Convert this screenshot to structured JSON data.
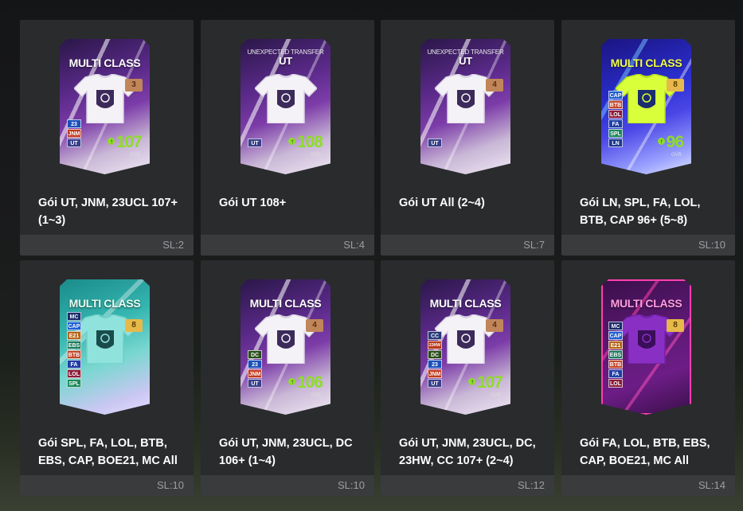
{
  "packs": [
    {
      "name": "Gói UT, JNM, 23UCL 107+ (1~3)",
      "footer": "SL:2",
      "card": {
        "theme": "purple",
        "subtitle": "",
        "title": "MULTI CLASS",
        "level": "3",
        "level_style": "bronze",
        "chips": [
          "23",
          "JNM",
          "UT"
        ],
        "ovr": "107",
        "ovr_label": "OVR",
        "jersey": "white-ut"
      }
    },
    {
      "name": "Gói UT 108+",
      "footer": "SL:4",
      "card": {
        "theme": "purple",
        "subtitle": "UNEXPECTED TRANSFER",
        "title": "UT",
        "level": "",
        "level_style": "bronze",
        "chips": [
          "UT"
        ],
        "ovr": "108",
        "ovr_label": "OVR",
        "jersey": "white-ut"
      }
    },
    {
      "name": "Gói UT All (2~4)",
      "footer": "SL:7",
      "card": {
        "theme": "purple",
        "subtitle": "UNEXPECTED TRANSFER",
        "title": "UT",
        "level": "4",
        "level_style": "bronze",
        "chips": [
          "UT"
        ],
        "ovr": "",
        "ovr_label": "",
        "jersey": "white-ut"
      }
    },
    {
      "name": "Gói LN, SPL, FA, LOL, BTB, CAP 96+ (5~8)",
      "footer": "SL:10",
      "card": {
        "theme": "blue",
        "subtitle": "",
        "title": "MULTI CLASS",
        "level": "8",
        "level_style": "gold",
        "chips": [
          "CAP",
          "BTB",
          "LOL",
          "FA",
          "SPL",
          "LN"
        ],
        "ovr": "96",
        "ovr_label": "OVR",
        "jersey": "yellow-lion"
      }
    },
    {
      "name": "Gói SPL, FA, LOL, BTB, EBS, CAP, BOE21, MC All",
      "footer": "SL:10",
      "card": {
        "theme": "teal",
        "subtitle": "",
        "title": "MULTI CLASS",
        "level": "8",
        "level_style": "gold",
        "chips": [
          "MC",
          "CAP",
          "E21",
          "EBS",
          "BTB",
          "FA",
          "LOL",
          "SPL"
        ],
        "ovr": "",
        "ovr_label": "",
        "jersey": "teal-eye"
      }
    },
    {
      "name": "Gói UT, JNM, 23UCL, DC 106+ (1~4)",
      "footer": "SL:10",
      "card": {
        "theme": "purple",
        "subtitle": "",
        "title": "MULTI CLASS",
        "level": "4",
        "level_style": "bronze",
        "chips": [
          "DC",
          "23",
          "JNM",
          "UT"
        ],
        "ovr": "106",
        "ovr_label": "OVR",
        "jersey": "white-ut"
      }
    },
    {
      "name": "Gói UT, JNM, 23UCL, DC, 23HW, CC 107+ (2~4)",
      "footer": "SL:12",
      "card": {
        "theme": "purple",
        "subtitle": "",
        "title": "MULTI CLASS",
        "level": "4",
        "level_style": "bronze",
        "chips": [
          "CC",
          "23HW",
          "DC",
          "23",
          "JNM",
          "UT"
        ],
        "ovr": "107",
        "ovr_label": "OVR",
        "jersey": "white-ut"
      }
    },
    {
      "name": "Gói FA, LOL, BTB, EBS, CAP, BOE21, MC All",
      "footer": "SL:14",
      "card": {
        "theme": "pink",
        "subtitle": "",
        "title": "MULTI CLASS",
        "level": "8",
        "level_style": "gold",
        "chips": [
          "MC",
          "CAP",
          "E21",
          "EBS",
          "BTB",
          "FA",
          "LOL"
        ],
        "ovr": "",
        "ovr_label": "",
        "jersey": "purple-crown"
      }
    }
  ],
  "chip_colors": {
    "23": "#1d4fb8",
    "JNM": "#c23a1e",
    "UT": "#3a3f8a",
    "CAP": "#1f5fd1",
    "BTB": "#c2462a",
    "LOL": "#8b1d3a",
    "FA": "#1f3fa6",
    "SPL": "#1b8a5a",
    "LN": "#1f3a8f",
    "MC": "#1a2b6b",
    "E21": "#b4661a",
    "EBS": "#1a7a5a",
    "DC": "#2b4d1a",
    "CC": "#2a3a7a",
    "23HW": "#b83a1a"
  }
}
